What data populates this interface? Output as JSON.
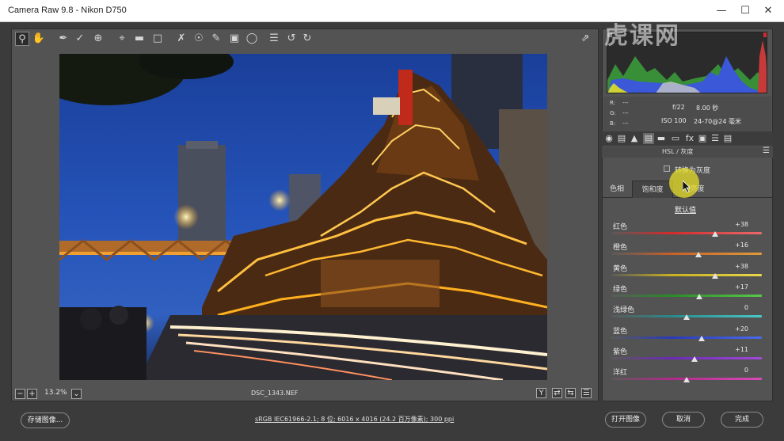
{
  "window": {
    "title": "Camera Raw 9.8 - Nikon D750"
  },
  "toolbar": {
    "tools": [
      "zoom-icon",
      "hand-icon",
      "white-balance-icon",
      "color-sampler-icon",
      "target-adjust-icon",
      "crop-icon",
      "straighten-icon",
      "transform-icon",
      "spot-removal-icon",
      "red-eye-icon",
      "adjustment-brush-icon",
      "graduated-filter-icon",
      "radial-filter-icon",
      "preferences-icon",
      "rotate-left-icon",
      "rotate-right-icon"
    ]
  },
  "status": {
    "zoom": "13.2%",
    "filename": "DSC_1343.NEF",
    "workflow": "sRGB IEC61966-2.1; 8 位; 6016 x 4016 (24.2 百万像素); 300 ppi"
  },
  "info": {
    "r_label": "R:",
    "g_label": "G:",
    "b_label": "B:",
    "r_val": "---",
    "g_val": "---",
    "b_val": "---",
    "aperture": "f/22",
    "shutter": "8.00 秒",
    "iso": "ISO 100",
    "lens": "24-70@24 毫米"
  },
  "panel": {
    "title": "HSL / 灰度",
    "grayscale_label": "转换为灰度",
    "tabs": [
      "色相",
      "饱和度",
      "明亮度"
    ],
    "selected_tab": 1,
    "default_link": "默认值",
    "sliders": [
      {
        "name": "红色",
        "value": "+38",
        "pos": 0.69
      },
      {
        "name": "橙色",
        "value": "+16",
        "pos": 0.58
      },
      {
        "name": "黄色",
        "value": "+38",
        "pos": 0.69
      },
      {
        "name": "绿色",
        "value": "+17",
        "pos": 0.585
      },
      {
        "name": "浅绿色",
        "value": "0",
        "pos": 0.5
      },
      {
        "name": "蓝色",
        "value": "+20",
        "pos": 0.6
      },
      {
        "name": "紫色",
        "value": "+11",
        "pos": 0.555
      },
      {
        "name": "洋红",
        "value": "0",
        "pos": 0.5
      }
    ]
  },
  "buttons": {
    "save": "存储图像...",
    "open": "打开图像",
    "cancel": "取消",
    "done": "完成"
  },
  "watermark": "虎课网",
  "colors": {
    "slider_red": "#d43a3a",
    "slider_orange": "#e07d22",
    "slider_yellow": "#d8c52a",
    "slider_green": "#3fae3a",
    "slider_aqua": "#36a8a6",
    "slider_blue": "#3a56d0",
    "slider_purple": "#8a40c8",
    "slider_magenta": "#c83aa6"
  }
}
